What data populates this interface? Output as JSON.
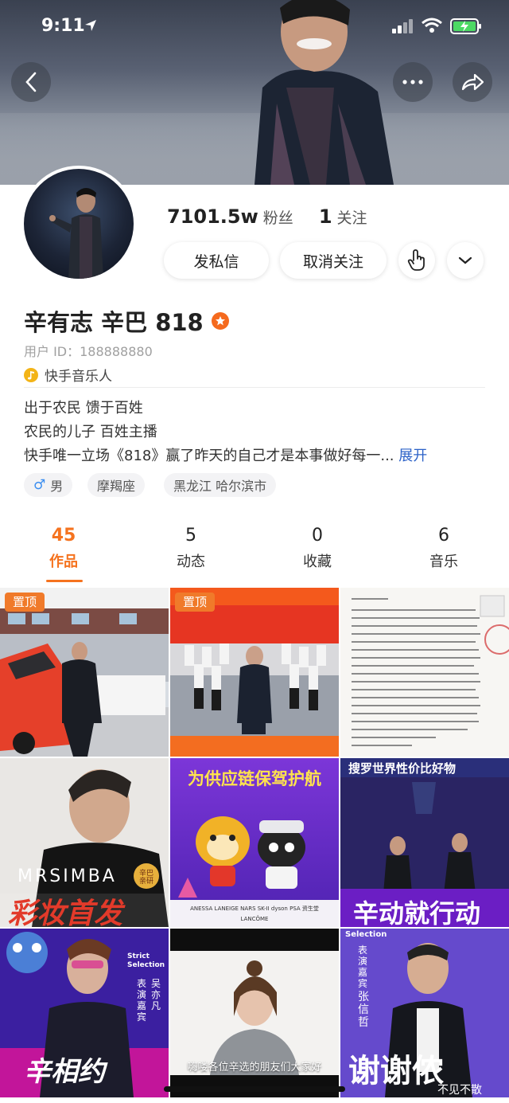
{
  "status_bar": {
    "time": "9:11"
  },
  "profile": {
    "followers_count": "7101.5w",
    "followers_label": "粉丝",
    "following_count": "1",
    "following_label": "关注",
    "message_button": "发私信",
    "unfollow_button": "取消关注",
    "name": "辛有志 辛巴 818",
    "user_id": "用户 ID：188888880",
    "certification": "快手音乐人",
    "bio_lines": [
      "出于农民 馈于百姓",
      "农民的儿子  百姓主播",
      "快手唯一立场《818》赢了昨天的自己才是本事做好每一..."
    ],
    "bio_expand": "展开",
    "tags": {
      "gender": "男",
      "zodiac": "摩羯座",
      "location": "黑龙江 哈尔滨市"
    }
  },
  "tabs": [
    {
      "count": "45",
      "label": "作品",
      "active": true
    },
    {
      "count": "5",
      "label": "动态",
      "active": false
    },
    {
      "count": "0",
      "label": "收藏",
      "active": false
    },
    {
      "count": "6",
      "label": "音乐",
      "active": false
    }
  ],
  "grid": {
    "pin_label": "置顶",
    "cells": [
      {
        "banner": ""
      },
      {
        "banner": ""
      },
      {
        "banner": ""
      },
      {
        "brand": "MRSIMBA",
        "headline": "彩妆首发",
        "seal": "辛巴亲研"
      },
      {
        "headline": "为供应链保驾护航",
        "brands": "ANESSA  LANEIGE  NARS  SK-II  dyson  PSA  资生堂",
        "sub": "LANCÔME"
      },
      {
        "top": "搜罗世界性价比好物",
        "headline": "辛动就行动"
      },
      {
        "corner": "Strict Selection",
        "role": "表演嘉宾",
        "guest": "吴亦凡",
        "headline": "辛相约"
      },
      {
        "caption": "嗨喽各位辛选的朋友们大家好"
      },
      {
        "corner": "Selection",
        "role": "表演嘉宾",
        "guest": "张信哲",
        "headline": "谢谢侬",
        "sub": "不见不散"
      }
    ]
  },
  "colors": {
    "accent": "#f5731f",
    "link": "#2c62c8",
    "pin": "#f07a2a"
  }
}
